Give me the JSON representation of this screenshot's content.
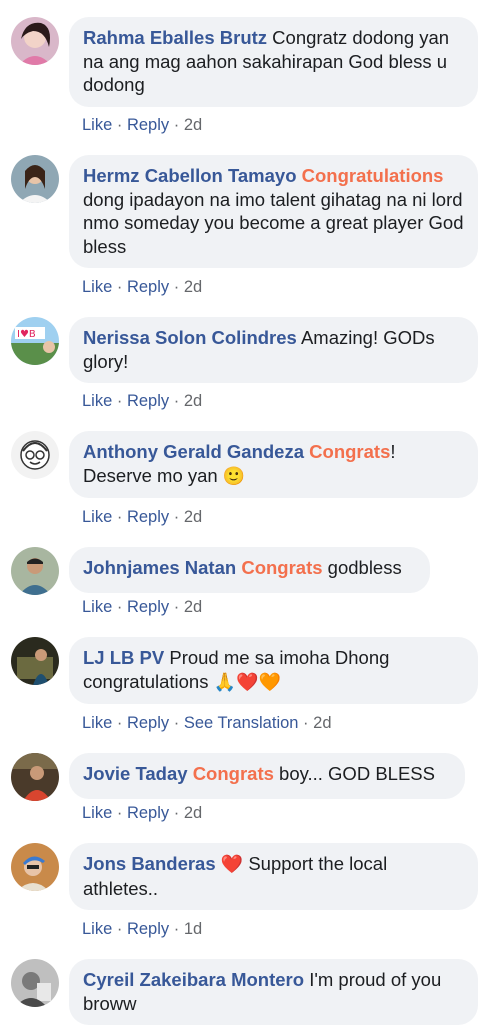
{
  "comments": [
    {
      "author": "Rahma Eballes Brutz",
      "text": "Congratz dodong yan na ang mag aahon sakahirapan God bless u dodong",
      "like": "Like",
      "reply": "Reply",
      "time": "2d"
    },
    {
      "author": "Hermz Cabellon Tamayo",
      "highlight": "Congratulations",
      "text": "dong ipadayon na imo talent gihatag na ni lord nmo someday you become a great player God bless",
      "like": "Like",
      "reply": "Reply",
      "time": "2d"
    },
    {
      "author": "Nerissa Solon Colindres",
      "text": "Amazing! GODs glory!",
      "like": "Like",
      "reply": "Reply",
      "time": "2d"
    },
    {
      "author": "Anthony Gerald Gandeza",
      "highlight": "Congrats",
      "text_after": "!",
      "text": "Deserve mo yan",
      "emoji": "🙂",
      "like": "Like",
      "reply": "Reply",
      "time": "2d"
    },
    {
      "author": "Johnjames Natan",
      "highlight": "Congrats",
      "text": "godbless",
      "like": "Like",
      "reply": "Reply",
      "time": "2d"
    },
    {
      "author": "LJ LB PV",
      "text": "Proud me sa imoha Dhong congratulations",
      "emoji": "🙏❤️🧡",
      "like": "Like",
      "reply": "Reply",
      "translate": "See Translation",
      "time": "2d"
    },
    {
      "author": "Jovie Taday",
      "highlight": "Congrats",
      "text": "boy... GOD BLESS",
      "like": "Like",
      "reply": "Reply",
      "time": "2d"
    },
    {
      "author": "Jons Banderas",
      "emoji": "❤️",
      "text": "Support the local athletes..",
      "like": "Like",
      "reply": "Reply",
      "time": "1d"
    },
    {
      "author": "Cyreil Zakeibara Montero",
      "text": "I'm proud of you broww"
    }
  ],
  "colors": {
    "author": "#385898",
    "highlight": "#f3704d",
    "bubble": "#f0f2f5",
    "text": "#1c1e21",
    "meta": "#65676b"
  }
}
